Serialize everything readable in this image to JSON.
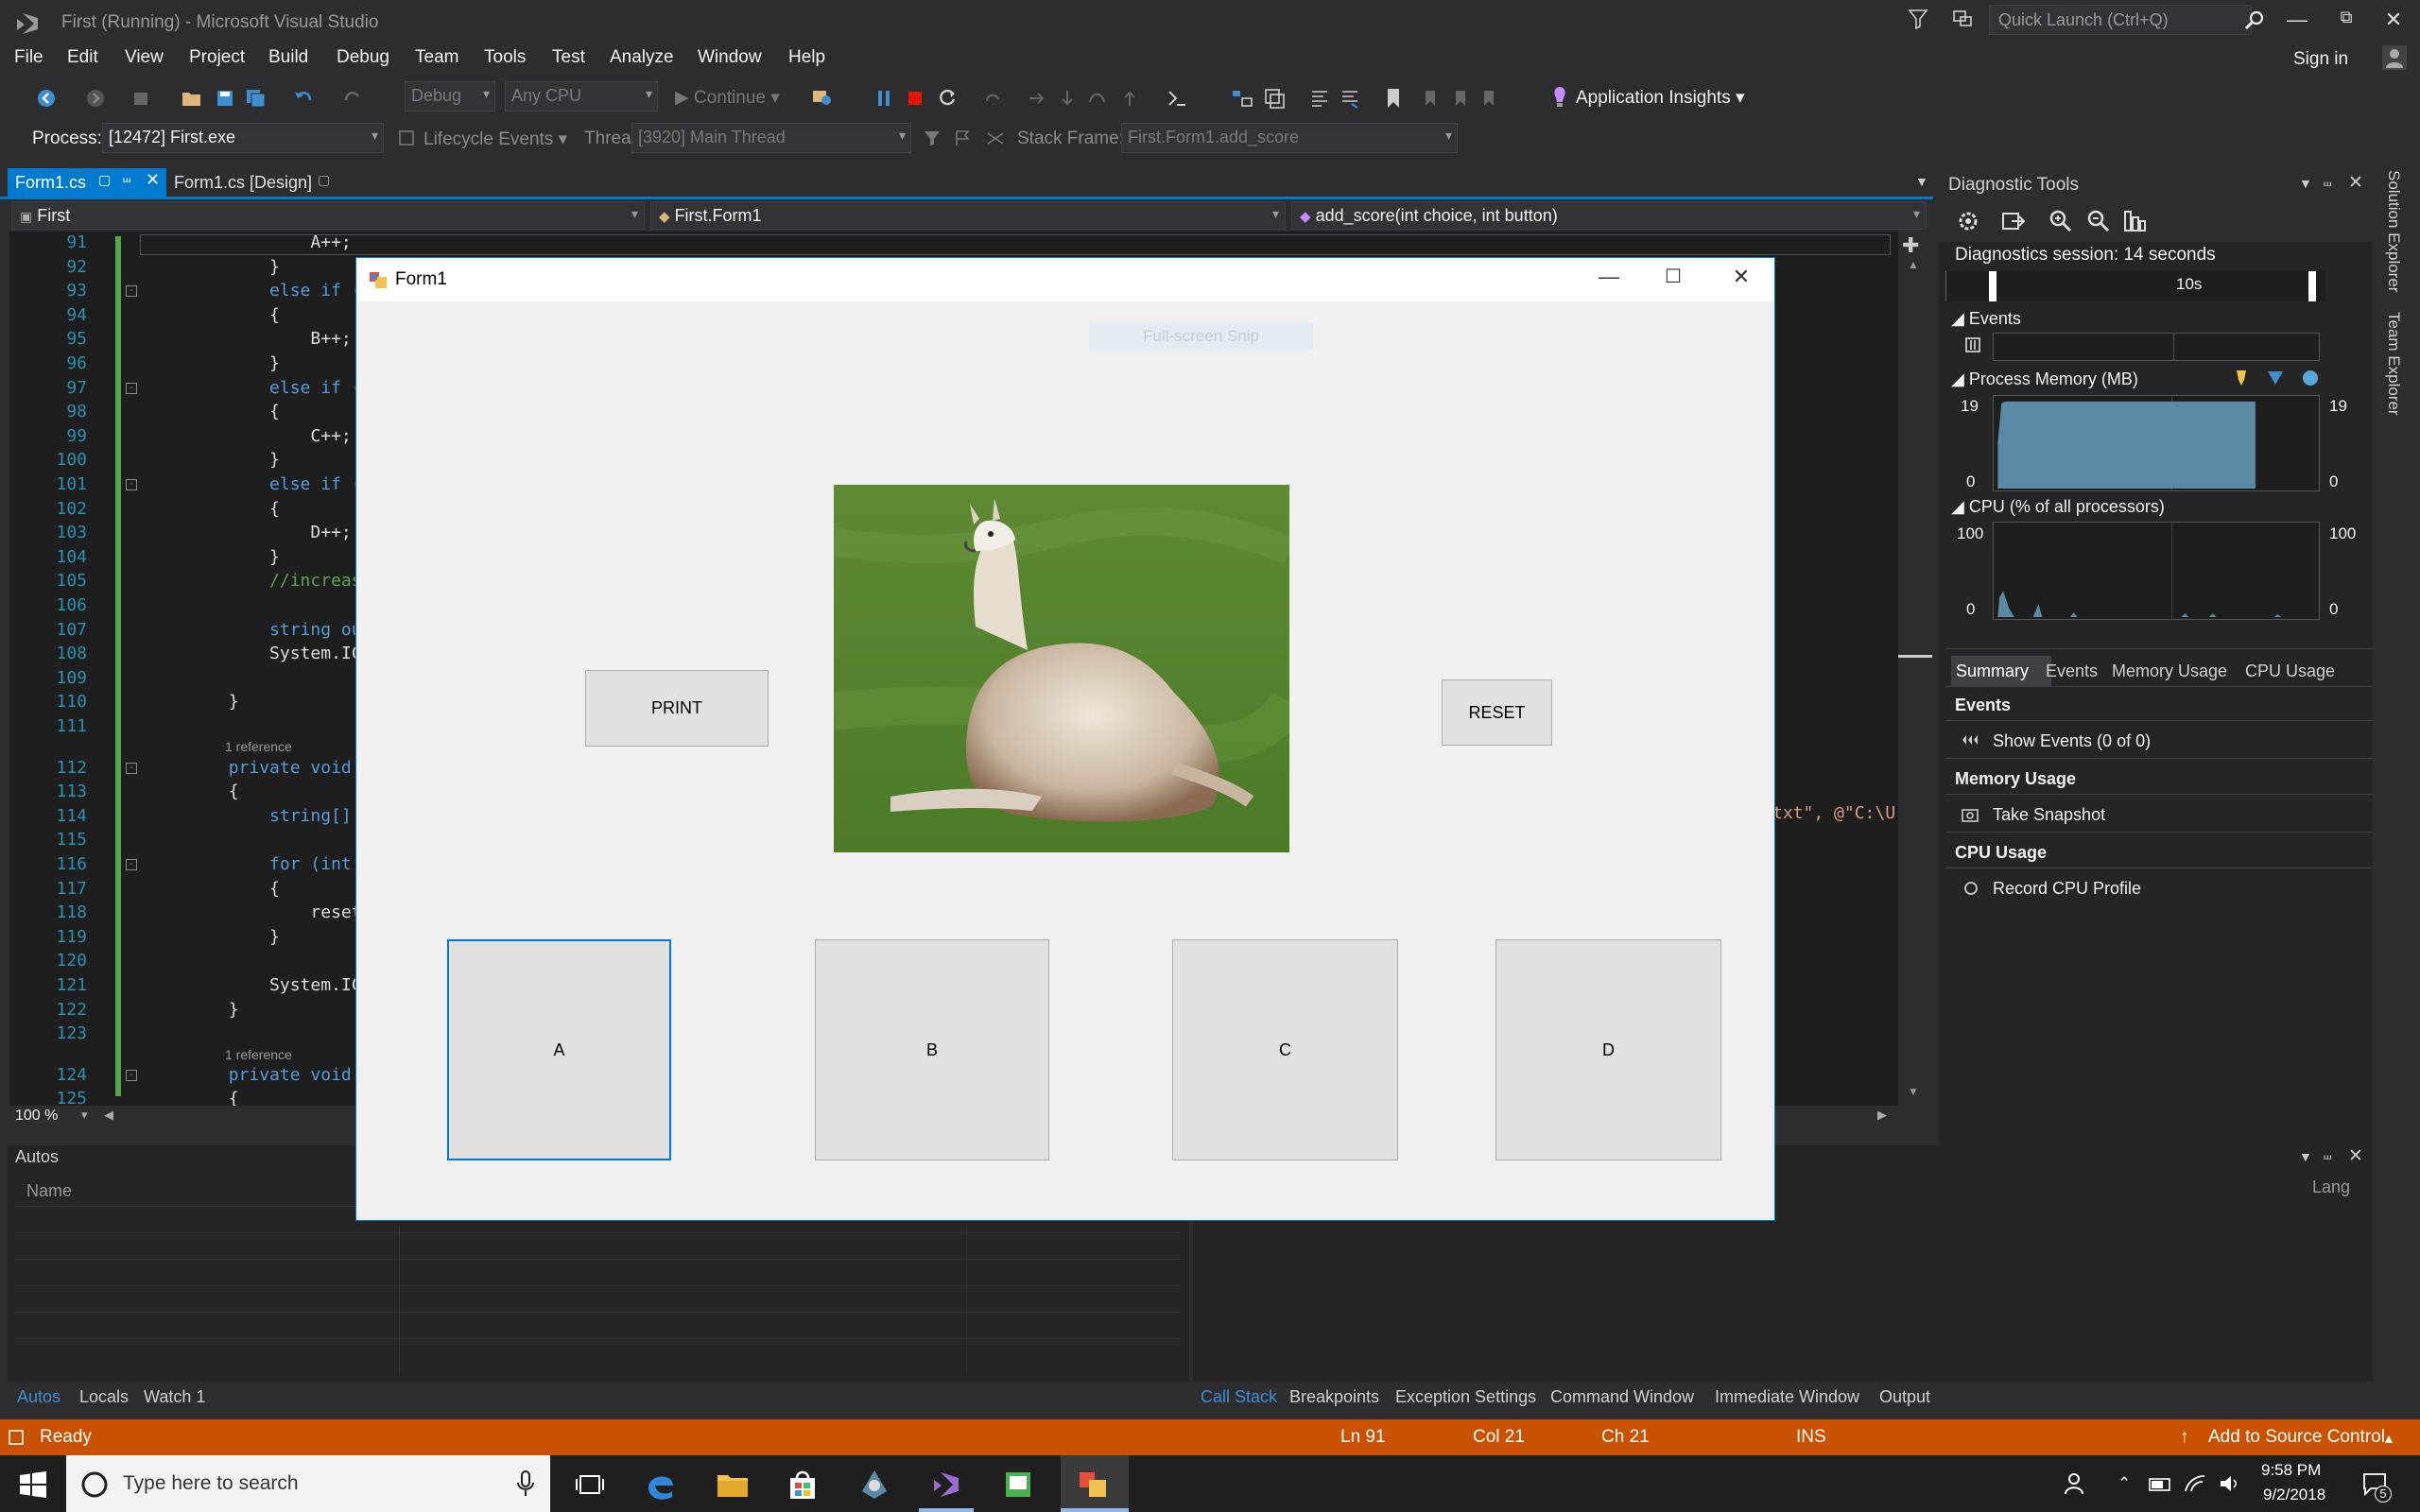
{
  "window": {
    "title": "First (Running) - Microsoft Visual Studio",
    "quick_launch": "Quick Launch (Ctrl+Q)",
    "sign_in": "Sign in"
  },
  "menu": [
    "File",
    "Edit",
    "View",
    "Project",
    "Build",
    "Debug",
    "Team",
    "Tools",
    "Test",
    "Analyze",
    "Window",
    "Help"
  ],
  "toolbar": {
    "config": "Debug",
    "platform": "Any CPU",
    "continue": "Continue",
    "app_insights": "Application Insights"
  },
  "debugbar": {
    "process_label": "Process:",
    "process": "[12472] First.exe",
    "lifecycle": "Lifecycle Events",
    "thread_label": "Thread:",
    "thread": "[3920] Main Thread",
    "stackframe_label": "Stack Frame:",
    "stackframe": "First.Form1.add_score"
  },
  "tabs": {
    "active": "Form1.cs",
    "design": "Form1.cs [Design]"
  },
  "navbar": {
    "project": "First",
    "class": "First.Form1",
    "member": "add_score(int choice, int button)"
  },
  "editor": {
    "lines": [
      {
        "n": "91",
        "code": "                A++;"
      },
      {
        "n": "92",
        "code": "            }"
      },
      {
        "n": "93",
        "code": "            else if ("
      },
      {
        "n": "94",
        "code": "            {"
      },
      {
        "n": "95",
        "code": "                B++;"
      },
      {
        "n": "96",
        "code": "            }"
      },
      {
        "n": "97",
        "code": "            else if ("
      },
      {
        "n": "98",
        "code": "            {"
      },
      {
        "n": "99",
        "code": "                C++;"
      },
      {
        "n": "100",
        "code": "            }"
      },
      {
        "n": "101",
        "code": "            else if ("
      },
      {
        "n": "102",
        "code": "            {"
      },
      {
        "n": "103",
        "code": "                D++;"
      },
      {
        "n": "104",
        "code": "            }"
      },
      {
        "n": "105",
        "code": "            //increas"
      },
      {
        "n": "106",
        "code": ""
      },
      {
        "n": "107",
        "code": "            string ou"
      },
      {
        "n": "108",
        "code": "            System.IC"
      },
      {
        "n": "109",
        "code": ""
      },
      {
        "n": "110",
        "code": "        }"
      },
      {
        "n": "111",
        "code": ""
      },
      {
        "n": "112",
        "code": "        private void"
      },
      {
        "n": "113",
        "code": "        {"
      },
      {
        "n": "114",
        "code": "            string[]"
      },
      {
        "n": "115",
        "code": ""
      },
      {
        "n": "116",
        "code": "            for (int"
      },
      {
        "n": "117",
        "code": "            {"
      },
      {
        "n": "118",
        "code": "                reset"
      },
      {
        "n": "119",
        "code": "            }"
      },
      {
        "n": "120",
        "code": ""
      },
      {
        "n": "121",
        "code": "            System.IC"
      },
      {
        "n": "122",
        "code": "        }"
      },
      {
        "n": "123",
        "code": ""
      },
      {
        "n": "124",
        "code": "        private void"
      },
      {
        "n": "125",
        "code": "        {"
      }
    ],
    "reference_label": "1 reference",
    "right_fragment": "txt\", @\"C:\\U",
    "zoom": "100 %"
  },
  "diagnostics": {
    "title": "Diagnostic Tools",
    "session": "Diagnostics session: 14 seconds",
    "timeline_mark": "10s",
    "events_label": "Events",
    "memory_label": "Process Memory (MB)",
    "memory_max": "19",
    "memory_min": "0",
    "cpu_label": "CPU (% of all processors)",
    "cpu_max": "100",
    "cpu_min": "0",
    "tabs": [
      "Summary",
      "Events",
      "Memory Usage",
      "CPU Usage"
    ],
    "events_header": "Events",
    "show_events": "Show Events (0 of 0)",
    "memory_header": "Memory Usage",
    "take_snapshot": "Take Snapshot",
    "cpu_header": "CPU Usage",
    "record_cpu": "Record CPU Profile",
    "side_tabs": [
      "Solution Explorer",
      "Team Explorer"
    ]
  },
  "autos": {
    "title": "Autos",
    "col_name": "Name",
    "col_lang": "Lang",
    "tabs": [
      "Autos",
      "Locals",
      "Watch 1"
    ]
  },
  "callstack": {
    "tabs": [
      "Call Stack",
      "Breakpoints",
      "Exception Settings",
      "Command Window",
      "Immediate Window",
      "Output"
    ]
  },
  "status": {
    "ready": "Ready",
    "ln": "Ln 91",
    "col": "Col 21",
    "ch": "Ch 21",
    "ins": "INS",
    "source_control": "Add to Source Control"
  },
  "taskbar": {
    "search": "Type here to search",
    "time": "9:58 PM",
    "date": "9/2/2018",
    "notif": "5"
  },
  "form": {
    "title": "Form1",
    "snip": "Full-screen Snip",
    "print": "PRINT",
    "reset": "RESET",
    "a": "A",
    "b": "B",
    "c": "C",
    "d": "D"
  },
  "colors": {
    "accent": "#007acc",
    "status": "#ca5100",
    "chart_fill": "#5a8aa6"
  }
}
